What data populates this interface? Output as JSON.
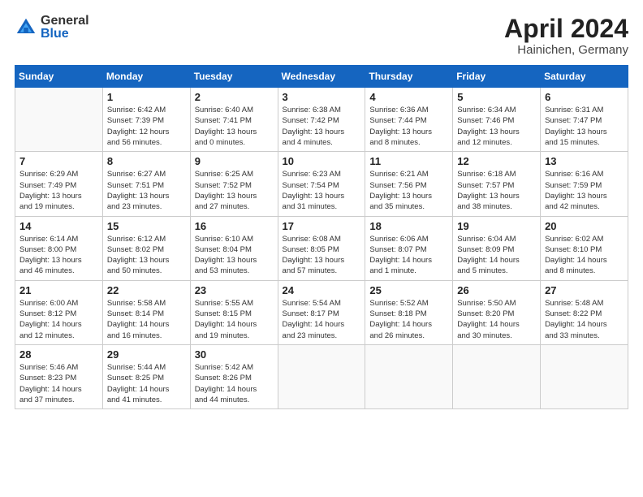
{
  "logo": {
    "general": "General",
    "blue": "Blue"
  },
  "title": {
    "month": "April 2024",
    "location": "Hainichen, Germany"
  },
  "weekdays": [
    "Sunday",
    "Monday",
    "Tuesday",
    "Wednesday",
    "Thursday",
    "Friday",
    "Saturday"
  ],
  "weeks": [
    [
      {
        "day": "",
        "info": ""
      },
      {
        "day": "1",
        "info": "Sunrise: 6:42 AM\nSunset: 7:39 PM\nDaylight: 12 hours\nand 56 minutes."
      },
      {
        "day": "2",
        "info": "Sunrise: 6:40 AM\nSunset: 7:41 PM\nDaylight: 13 hours\nand 0 minutes."
      },
      {
        "day": "3",
        "info": "Sunrise: 6:38 AM\nSunset: 7:42 PM\nDaylight: 13 hours\nand 4 minutes."
      },
      {
        "day": "4",
        "info": "Sunrise: 6:36 AM\nSunset: 7:44 PM\nDaylight: 13 hours\nand 8 minutes."
      },
      {
        "day": "5",
        "info": "Sunrise: 6:34 AM\nSunset: 7:46 PM\nDaylight: 13 hours\nand 12 minutes."
      },
      {
        "day": "6",
        "info": "Sunrise: 6:31 AM\nSunset: 7:47 PM\nDaylight: 13 hours\nand 15 minutes."
      }
    ],
    [
      {
        "day": "7",
        "info": "Sunrise: 6:29 AM\nSunset: 7:49 PM\nDaylight: 13 hours\nand 19 minutes."
      },
      {
        "day": "8",
        "info": "Sunrise: 6:27 AM\nSunset: 7:51 PM\nDaylight: 13 hours\nand 23 minutes."
      },
      {
        "day": "9",
        "info": "Sunrise: 6:25 AM\nSunset: 7:52 PM\nDaylight: 13 hours\nand 27 minutes."
      },
      {
        "day": "10",
        "info": "Sunrise: 6:23 AM\nSunset: 7:54 PM\nDaylight: 13 hours\nand 31 minutes."
      },
      {
        "day": "11",
        "info": "Sunrise: 6:21 AM\nSunset: 7:56 PM\nDaylight: 13 hours\nand 35 minutes."
      },
      {
        "day": "12",
        "info": "Sunrise: 6:18 AM\nSunset: 7:57 PM\nDaylight: 13 hours\nand 38 minutes."
      },
      {
        "day": "13",
        "info": "Sunrise: 6:16 AM\nSunset: 7:59 PM\nDaylight: 13 hours\nand 42 minutes."
      }
    ],
    [
      {
        "day": "14",
        "info": "Sunrise: 6:14 AM\nSunset: 8:00 PM\nDaylight: 13 hours\nand 46 minutes."
      },
      {
        "day": "15",
        "info": "Sunrise: 6:12 AM\nSunset: 8:02 PM\nDaylight: 13 hours\nand 50 minutes."
      },
      {
        "day": "16",
        "info": "Sunrise: 6:10 AM\nSunset: 8:04 PM\nDaylight: 13 hours\nand 53 minutes."
      },
      {
        "day": "17",
        "info": "Sunrise: 6:08 AM\nSunset: 8:05 PM\nDaylight: 13 hours\nand 57 minutes."
      },
      {
        "day": "18",
        "info": "Sunrise: 6:06 AM\nSunset: 8:07 PM\nDaylight: 14 hours\nand 1 minute."
      },
      {
        "day": "19",
        "info": "Sunrise: 6:04 AM\nSunset: 8:09 PM\nDaylight: 14 hours\nand 5 minutes."
      },
      {
        "day": "20",
        "info": "Sunrise: 6:02 AM\nSunset: 8:10 PM\nDaylight: 14 hours\nand 8 minutes."
      }
    ],
    [
      {
        "day": "21",
        "info": "Sunrise: 6:00 AM\nSunset: 8:12 PM\nDaylight: 14 hours\nand 12 minutes."
      },
      {
        "day": "22",
        "info": "Sunrise: 5:58 AM\nSunset: 8:14 PM\nDaylight: 14 hours\nand 16 minutes."
      },
      {
        "day": "23",
        "info": "Sunrise: 5:55 AM\nSunset: 8:15 PM\nDaylight: 14 hours\nand 19 minutes."
      },
      {
        "day": "24",
        "info": "Sunrise: 5:54 AM\nSunset: 8:17 PM\nDaylight: 14 hours\nand 23 minutes."
      },
      {
        "day": "25",
        "info": "Sunrise: 5:52 AM\nSunset: 8:18 PM\nDaylight: 14 hours\nand 26 minutes."
      },
      {
        "day": "26",
        "info": "Sunrise: 5:50 AM\nSunset: 8:20 PM\nDaylight: 14 hours\nand 30 minutes."
      },
      {
        "day": "27",
        "info": "Sunrise: 5:48 AM\nSunset: 8:22 PM\nDaylight: 14 hours\nand 33 minutes."
      }
    ],
    [
      {
        "day": "28",
        "info": "Sunrise: 5:46 AM\nSunset: 8:23 PM\nDaylight: 14 hours\nand 37 minutes."
      },
      {
        "day": "29",
        "info": "Sunrise: 5:44 AM\nSunset: 8:25 PM\nDaylight: 14 hours\nand 41 minutes."
      },
      {
        "day": "30",
        "info": "Sunrise: 5:42 AM\nSunset: 8:26 PM\nDaylight: 14 hours\nand 44 minutes."
      },
      {
        "day": "",
        "info": ""
      },
      {
        "day": "",
        "info": ""
      },
      {
        "day": "",
        "info": ""
      },
      {
        "day": "",
        "info": ""
      }
    ]
  ]
}
